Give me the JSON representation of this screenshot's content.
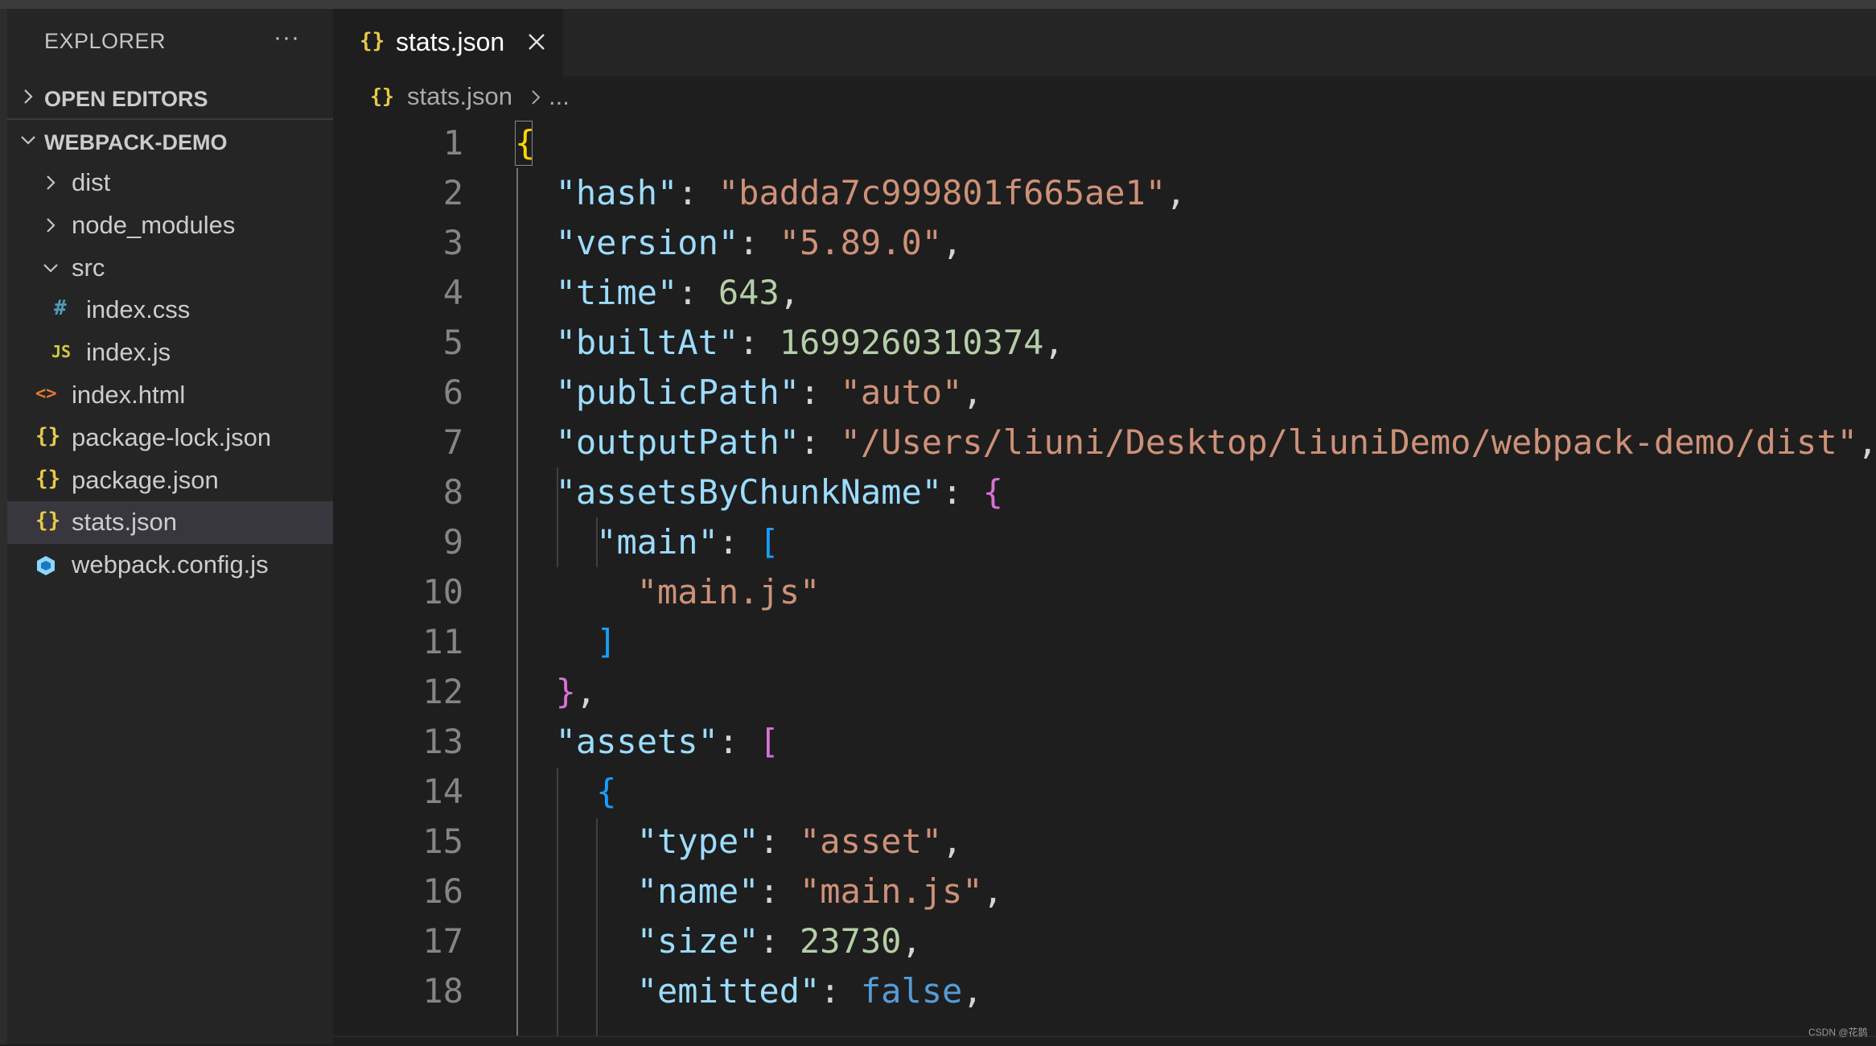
{
  "sidebar": {
    "title": "EXPLORER",
    "more": "···",
    "open_editors": "OPEN EDITORS",
    "project": "WEBPACK-DEMO",
    "items": [
      {
        "label": "dist",
        "icon": ""
      },
      {
        "label": "node_modules",
        "icon": ""
      },
      {
        "label": "src",
        "icon": ""
      },
      {
        "label": "index.css",
        "icon": "#"
      },
      {
        "label": "index.js",
        "icon": "JS"
      },
      {
        "label": "index.html",
        "icon": "<>"
      },
      {
        "label": "package-lock.json",
        "icon": "{}"
      },
      {
        "label": "package.json",
        "icon": "{}"
      },
      {
        "label": "stats.json",
        "icon": "{}"
      },
      {
        "label": "webpack.config.js",
        "icon": ""
      }
    ]
  },
  "tab": {
    "label": "stats.json",
    "icon": "{}"
  },
  "breadcrumb": {
    "file": "stats.json",
    "rest": "..."
  },
  "code": {
    "line_numbers": [
      "1",
      "2",
      "3",
      "4",
      "5",
      "6",
      "7",
      "8",
      "9",
      "10",
      "11",
      "12",
      "13",
      "14",
      "15",
      "16",
      "17",
      "18"
    ],
    "tokens": {
      "l1_brace": "{",
      "l2_key": "\"hash\"",
      "l2_val": "\"badda7c999801f665ae1\"",
      "l3_key": "\"version\"",
      "l3_val": "\"5.89.0\"",
      "l4_key": "\"time\"",
      "l4_val": "643",
      "l5_key": "\"builtAt\"",
      "l5_val": "1699260310374",
      "l6_key": "\"publicPath\"",
      "l6_val": "\"auto\"",
      "l7_key": "\"outputPath\"",
      "l7_val": "\"/Users/liuni/Desktop/liuniDemo/webpack-demo/dist\"",
      "l8_key": "\"assetsByChunkName\"",
      "l8_brace": "{",
      "l9_key": "\"main\"",
      "l9_bracket": "[",
      "l10_val": "\"main.js\"",
      "l11_bracket": "]",
      "l12_brace": "}",
      "l13_key": "\"assets\"",
      "l13_bracket": "[",
      "l14_brace": "{",
      "l15_key": "\"type\"",
      "l15_val": "\"asset\"",
      "l16_key": "\"name\"",
      "l16_val": "\"main.js\"",
      "l17_key": "\"size\"",
      "l17_val": "23730",
      "l18_key": "\"emitted\"",
      "l18_val": "false"
    }
  },
  "watermark": "CSDN @花鹊",
  "colors": {
    "key": "#9cdcfe",
    "string": "#ce9178",
    "number": "#b5cea8",
    "boolean": "#569cd6",
    "brace_gold": "#ffd700",
    "brace_magenta": "#da70d6",
    "brace_blue": "#179fff"
  }
}
